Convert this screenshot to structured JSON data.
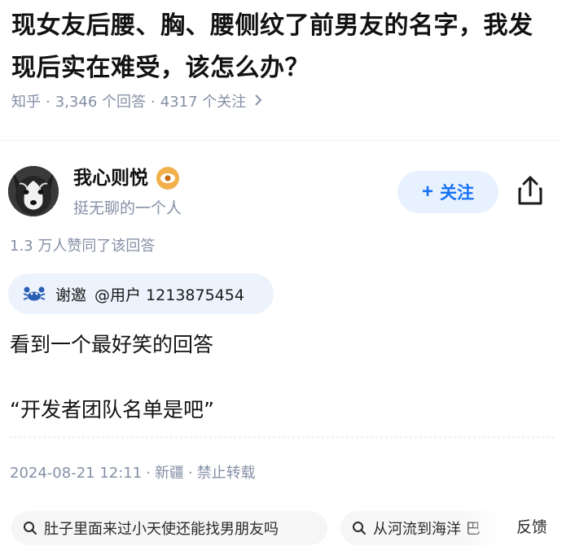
{
  "question": {
    "title": "现女友后腰、胸、腰侧纹了前男友的名字，我发现后实在难受，该怎么办？",
    "source": "知乎",
    "answers_count": "3,346 个回答",
    "followers_count": "4317 个关注",
    "separator": "·"
  },
  "author": {
    "name": "我心则悦",
    "bio": "挺无聊的一个人",
    "follow_label": "关注",
    "badge_icon": "eye-badge-icon",
    "avatar_icon": "husky-dog-avatar"
  },
  "answer": {
    "upvote_info": "1.3 万人赞同了该回答",
    "invite_label": "谢邀",
    "invite_user": "@用户 1213875454",
    "line1": "看到一个最好笑的回答",
    "line2": "“开发者团队名单是吧”",
    "date": "2024-08-21 12:11",
    "location": "新疆",
    "repost": "禁止转载",
    "separator": "·"
  },
  "related_searches": [
    {
      "text": "肚子里面来过小天使还能找男朋友吗"
    },
    {
      "text": "从河流到海洋 巴"
    }
  ],
  "feedback_label": "反馈",
  "colors": {
    "accent": "#1772f6",
    "muted": "#8590a6",
    "chip_bg": "#e8f1fe"
  }
}
